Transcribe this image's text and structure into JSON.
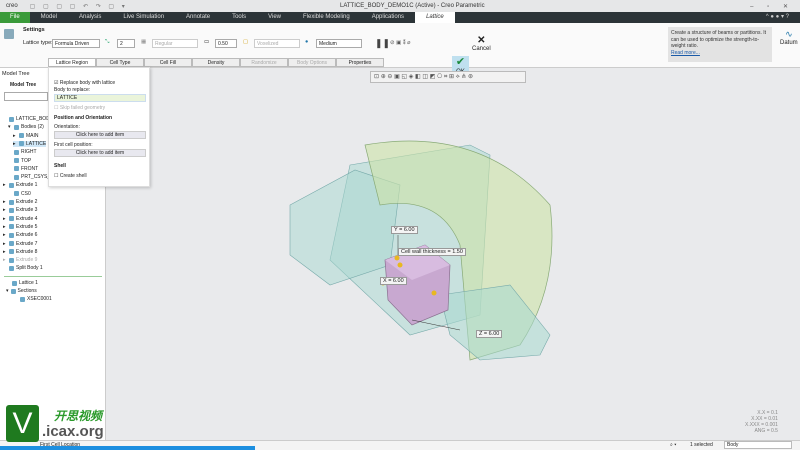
{
  "window": {
    "logo": "creo",
    "title": "LATTICE_BODY_DEMO1C (Active) - Creo Parametric",
    "controls": "– ▫ ✕"
  },
  "menu": [
    "File",
    "Model",
    "Analysis",
    "Live Simulation",
    "Annotate",
    "Tools",
    "View",
    "Flexible Modeling",
    "Applications",
    "Lattice"
  ],
  "ribbon": {
    "settings": "Settings",
    "lattice_type_label": "Lattice type:",
    "lattice_type": "Formula Driven",
    "cells": "2",
    "cell_shape": "Regular",
    "size": "0.50",
    "voxel": "Voxelized",
    "quality": "Medium",
    "ok": "OK",
    "cancel": "Cancel",
    "datum": "Datum",
    "help": "Create a structure of beams or partitions. It can be used to optimize the strength-to-weight ratio.",
    "read_more": "Read more..."
  },
  "tabs": [
    "Lattice Region",
    "Cell Type",
    "Cell Fill",
    "Density",
    "Randomize",
    "Body Options",
    "Properties"
  ],
  "panel": {
    "replace": "Replace body with lattice",
    "body_label": "Body to replace:",
    "body": "LATTICE",
    "skip": "Skip failed geometry",
    "pos_heading": "Position and Orientation",
    "orientation": "Orientation:",
    "add": "Click here to add item",
    "first_cell": "First cell position:",
    "shell": "Shell",
    "create_shell": "Create shell"
  },
  "tree": {
    "header": "Model Tree",
    "sub": "Model Tree",
    "items": [
      "LATTICE_BODY_D",
      "Bodies (2)",
      "MAIN",
      "LATTICE",
      "RIGHT",
      "TOP",
      "FRONT",
      "PRT_CSYS_D",
      "Extrude 1",
      "CS0",
      "Extrude 2",
      "Extrude 3",
      "Extrude 4",
      "Extrude 5",
      "Extrude 6",
      "Extrude 7",
      "Extrude 8",
      "Extrude 9",
      "Split Body 1"
    ],
    "bottom": [
      "Lattice 1",
      "Sections",
      "XSEC0001"
    ]
  },
  "dims": {
    "y": "Y = 6.00",
    "x": "X = 6.00",
    "z": "Z = 6.00",
    "wall": "Cell wall thickness = 1.50"
  },
  "accuracy": [
    "X.X = 0.1",
    "X.XX = 0.01",
    "X.XXX = 0.001",
    "ANG = 0.5"
  ],
  "status": {
    "message": "First Cell Location",
    "selected": "1 selected",
    "filter": "Body"
  },
  "watermark": {
    "text1": "开思视频",
    "text2": ".icax.org"
  }
}
